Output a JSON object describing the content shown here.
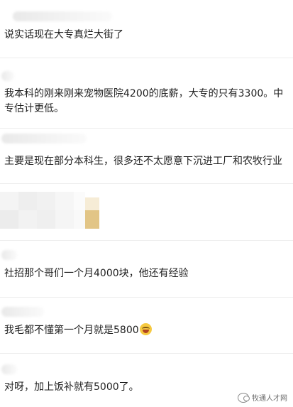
{
  "comments": [
    {
      "text": "说实话现在大专真烂大街了"
    },
    {
      "text": "我本科的刚来刚来宠物医院4200的底薪，大专的只有3300。中专估计更低。"
    },
    {
      "text": "主要是现在部分本科生，很多还不太愿意下沉进工厂和农牧行业"
    },
    {
      "text": "社招那个哥们一个月4000块，他还有经验"
    },
    {
      "text": "我毛都不懂第一个月就是5800"
    },
    {
      "text": "对呀，加上饭补就有5000了。"
    }
  ],
  "emoji": {
    "name": "laughing-crying-emoji-icon"
  },
  "watermark": {
    "text": "牧通人才网",
    "icon": "wechat-icon"
  }
}
